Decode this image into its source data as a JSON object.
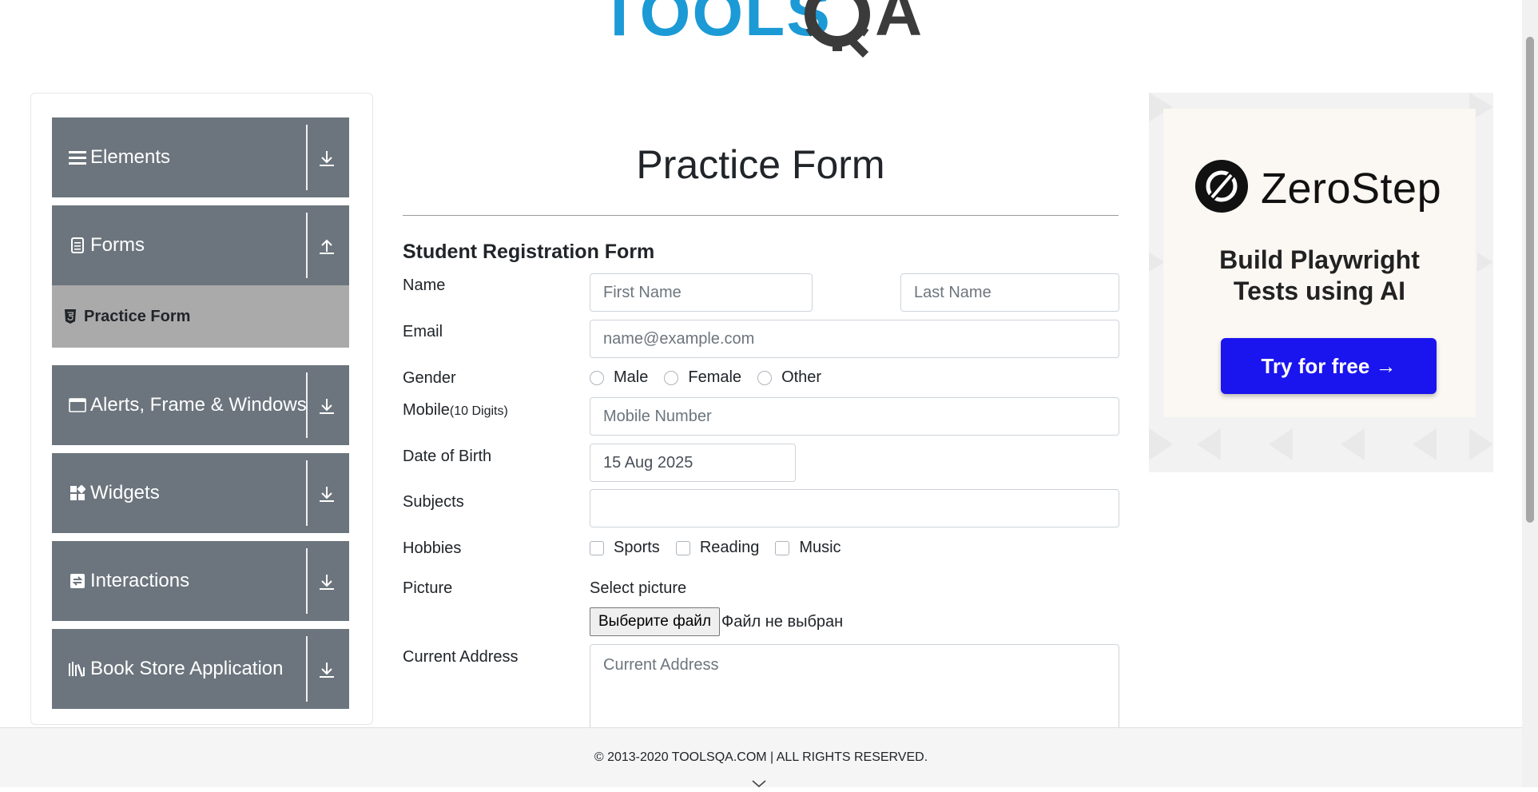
{
  "header": {
    "logo_text": "TOOLSQA",
    "logo_part_left": "TOOLS",
    "logo_part_right": "A"
  },
  "sidebar": {
    "groups": [
      {
        "label": "Elements",
        "icon": "list-icon",
        "expanded": false
      },
      {
        "label": "Forms",
        "icon": "form-icon",
        "expanded": true,
        "items": [
          {
            "label": "Practice Form",
            "icon": "html5-icon",
            "active": true
          }
        ]
      },
      {
        "label": "Alerts, Frame & Windows",
        "icon": "window-icon",
        "expanded": false
      },
      {
        "label": "Widgets",
        "icon": "widgets-icon",
        "expanded": false
      },
      {
        "label": "Interactions",
        "icon": "interactions-icon",
        "expanded": false
      },
      {
        "label": "Book Store Application",
        "icon": "books-icon",
        "expanded": false
      }
    ]
  },
  "main": {
    "page_title": "Practice Form",
    "form_title": "Student Registration Form",
    "labels": {
      "name": "Name",
      "email": "Email",
      "gender": "Gender",
      "mobile": "Mobile",
      "mobile_hint": "(10 Digits)",
      "dob": "Date of Birth",
      "subjects": "Subjects",
      "hobbies": "Hobbies",
      "picture": "Picture",
      "address": "Current Address"
    },
    "placeholders": {
      "first_name": "First Name",
      "last_name": "Last Name",
      "email": "name@example.com",
      "mobile": "Mobile Number",
      "address": "Current Address"
    },
    "values": {
      "dob": "15 Aug 2025",
      "subjects": ""
    },
    "gender_options": [
      "Male",
      "Female",
      "Other"
    ],
    "hobby_options": [
      "Sports",
      "Reading",
      "Music"
    ],
    "picture": {
      "caption": "Select picture",
      "button": "Выберите файл",
      "status": "Файл не выбран"
    }
  },
  "ad": {
    "brand": "ZeroStep",
    "tagline_line1": "Build Playwright",
    "tagline_line2": "Tests using AI",
    "cta": "Try for free →",
    "cta_color": "#1a15ee"
  },
  "footer": {
    "text": "© 2013-2020 TOOLSQA.COM | ALL RIGHTS RESERVED."
  },
  "colors": {
    "sidebar_header": "#6c757d",
    "sidebar_active": "#aaaaaa",
    "logo_blue": "#1b9ad6",
    "logo_dark": "#3b3b3b"
  }
}
